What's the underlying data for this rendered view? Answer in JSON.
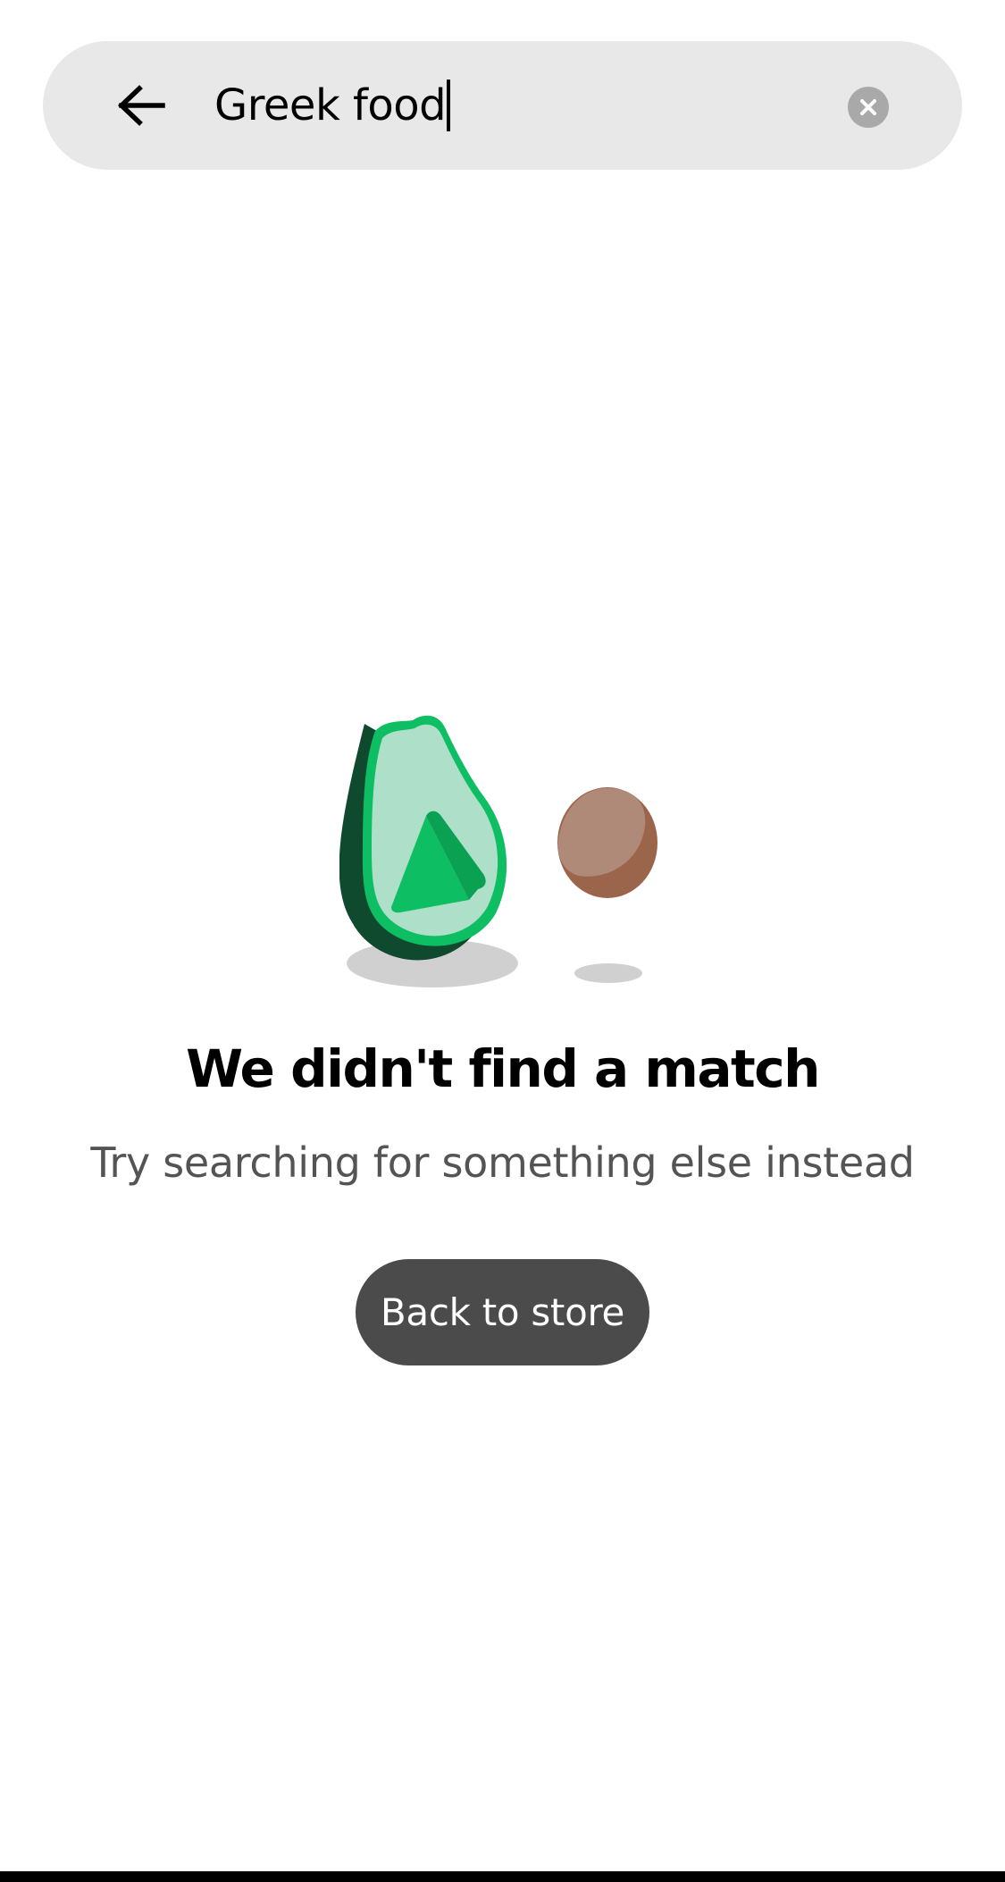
{
  "search": {
    "query": "Greek food",
    "back_icon": "arrow-left-icon",
    "clear_icon": "clear-circle-icon"
  },
  "empty_state": {
    "illustration": "avocado-and-pit-illustration",
    "title": "We didn't find a match",
    "subtitle": "Try searching for something else instead",
    "button_label": "Back to store"
  },
  "colors": {
    "search_bg": "#e8e8e8",
    "button_bg": "#4b4b4b",
    "avocado_green": "#0ebe63",
    "avocado_dark": "#0f4a2e",
    "avocado_flesh": "#aedfc9",
    "pit_brown": "#9b654c",
    "pit_light": "#b08a78"
  }
}
